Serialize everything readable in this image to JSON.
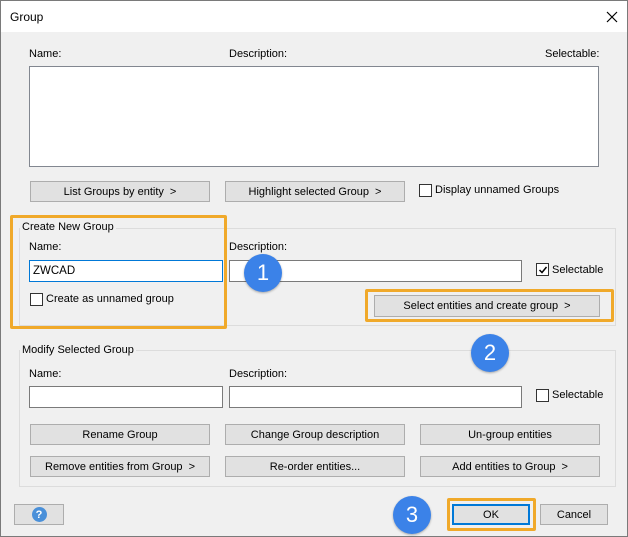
{
  "window": {
    "title": "Group",
    "close_glyph": "✕"
  },
  "groups_list": {
    "col_name": "Name:",
    "col_description": "Description:",
    "col_selectable": "Selectable:"
  },
  "list_actions": {
    "list_by_entity": "List Groups by entity",
    "highlight_selected": "Highlight selected Group",
    "display_unnamed": "Display unnamed Groups",
    "arrow": ">"
  },
  "create_group": {
    "title": "Create New Group",
    "name_label": "Name:",
    "name_value": "ZWCAD",
    "description_label": "Description:",
    "description_value": "",
    "selectable_label": "Selectable",
    "selectable_checked": true,
    "unnamed_label": "Create as unnamed group",
    "unnamed_checked": false,
    "select_create_button": "Select entities and create group"
  },
  "modify_group": {
    "title": "Modify Selected Group",
    "name_label": "Name:",
    "name_value": "",
    "description_label": "Description:",
    "description_value": "",
    "selectable_label": "Selectable",
    "selectable_checked": false,
    "rename": "Rename Group",
    "change_description": "Change Group description",
    "ungroup": "Un-group entities",
    "remove_entities": "Remove entities from Group",
    "reorder": "Re-order entities...",
    "add_entities": "Add entities to Group"
  },
  "footer": {
    "help_glyph": "?",
    "ok": "OK",
    "cancel": "Cancel"
  },
  "annotations": {
    "step1": "1",
    "step2": "2",
    "step3": "3"
  },
  "colors": {
    "highlight": "#f0a92a",
    "step_badge": "#3b82e8",
    "focus": "#0078d7"
  }
}
